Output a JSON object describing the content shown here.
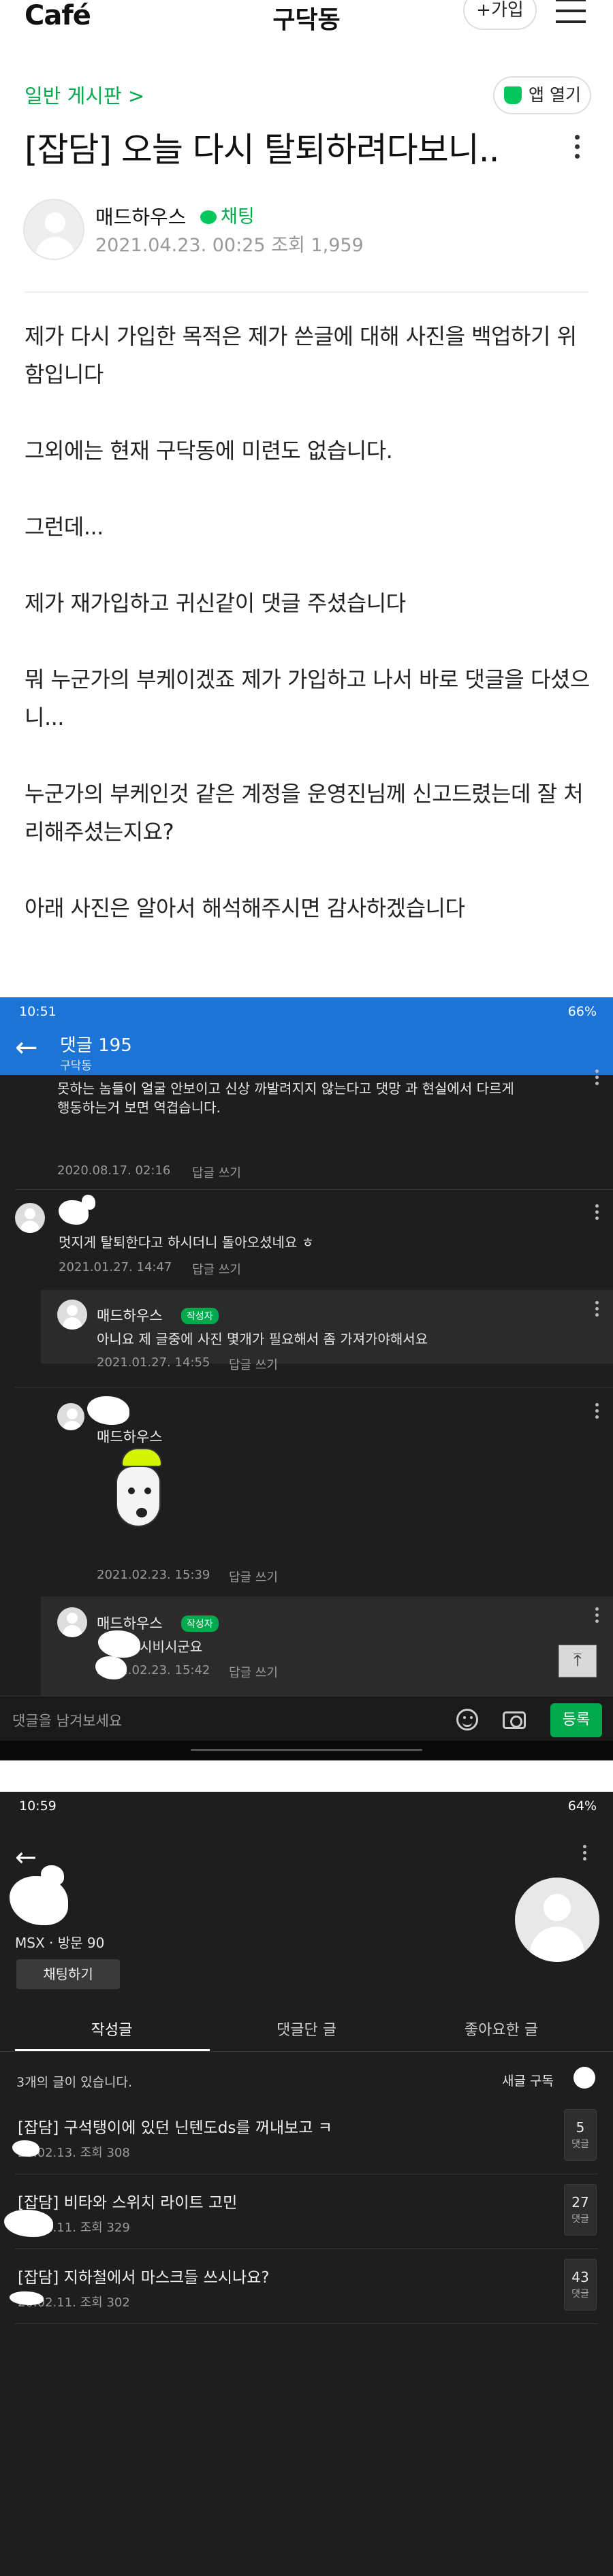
{
  "header": {
    "logo": "Café",
    "cafe_name": "구닥동",
    "join_label": "+가입"
  },
  "article": {
    "board_link": "일반 게시판 >",
    "app_open_label": "앱 열기",
    "title": "[잡담] 오늘 다시 탈퇴하려다보니..",
    "author": "매드하우스",
    "chat_label": "채팅",
    "date": "2021.04.23. 00:25",
    "views": "조회 1,959",
    "paragraphs": [
      "제가 다시 가입한 목적은 제가 쓴글에 대해 사진을 백업하기 위함입니다",
      "그외에는 현재 구닥동에 미련도 없습니다.",
      "그런데...",
      "제가 재가입하고 귀신같이 댓글 주셨습니다",
      "뭐 누군가의 부케이겠죠 제가 가입하고 나서 바로 댓글을 다셨으니...",
      "누군가의 부케인것 같은 계정을 운영진님께 신고드렸는데 잘 처리해주셨는지요?",
      "아래 사진은 알아서 해석해주시면 감사하겠습니다"
    ]
  },
  "shot1": {
    "status_time": "10:51",
    "status_right": "66%",
    "title": "댓글 195",
    "subtitle": "구닥동",
    "comments": [
      {
        "text_line1": "못하는 놈들이 얼굴 안보이고 신상 까발려지지 않는다고 댓망 과 현실에서 다르게",
        "text_line2": "행동하는거 보면 역겹습니다.",
        "date": "2020.08.17. 02:16",
        "reply": "답글 쓰기"
      },
      {
        "text": "멋지게 탈퇴한다고 하시더니 돌아오셨네요 ㅎ",
        "date": "2021.01.27. 14:47",
        "reply": "답글 쓰기"
      },
      {
        "name": "매드하우스",
        "badge": "작성자",
        "text": "아니요 제 글중에 사진 몇개가 필요해서 좀 가져가야해서요",
        "date": "2021.01.27. 14:55",
        "reply": "답글 쓰기"
      },
      {
        "name": "매드하우스",
        "date": "2021.02.23. 15:39",
        "reply": "답글 쓰기"
      },
      {
        "name": "매드하우스",
        "badge": "작성자",
        "text": "계속 시비시군요",
        "date": "2021.02.23. 15:42",
        "reply": "답글 쓰기"
      }
    ],
    "input_placeholder": "댓글을 남겨보세요",
    "submit_label": "등록"
  },
  "shot2": {
    "status_time": "10:59",
    "status_right": "64%",
    "profile_meta": "MSX · 방문 90",
    "chat_button": "채팅하기",
    "tabs": [
      "작성글",
      "댓글단 글",
      "좋아요한 글"
    ],
    "post_count_text": "3개의 글이 있습니다.",
    "new_subscribe": "새글 구독",
    "posts": [
      {
        "title": "[잡담] 구석탱이에 있던 닌텐도ds를 꺼내보고 ㅋ",
        "meta": "20.02.13.  조회 308",
        "count": "5",
        "count_label": "댓글"
      },
      {
        "title": "[잡담] 비타와 스위치 라이트 고민",
        "meta": "20.02.11.  조회 329",
        "count": "27",
        "count_label": "댓글"
      },
      {
        "title": "[잡담] 지하철에서 마스크들 쓰시나요?",
        "meta": "20.02.11.  조회 302",
        "count": "43",
        "count_label": "댓글"
      }
    ]
  }
}
